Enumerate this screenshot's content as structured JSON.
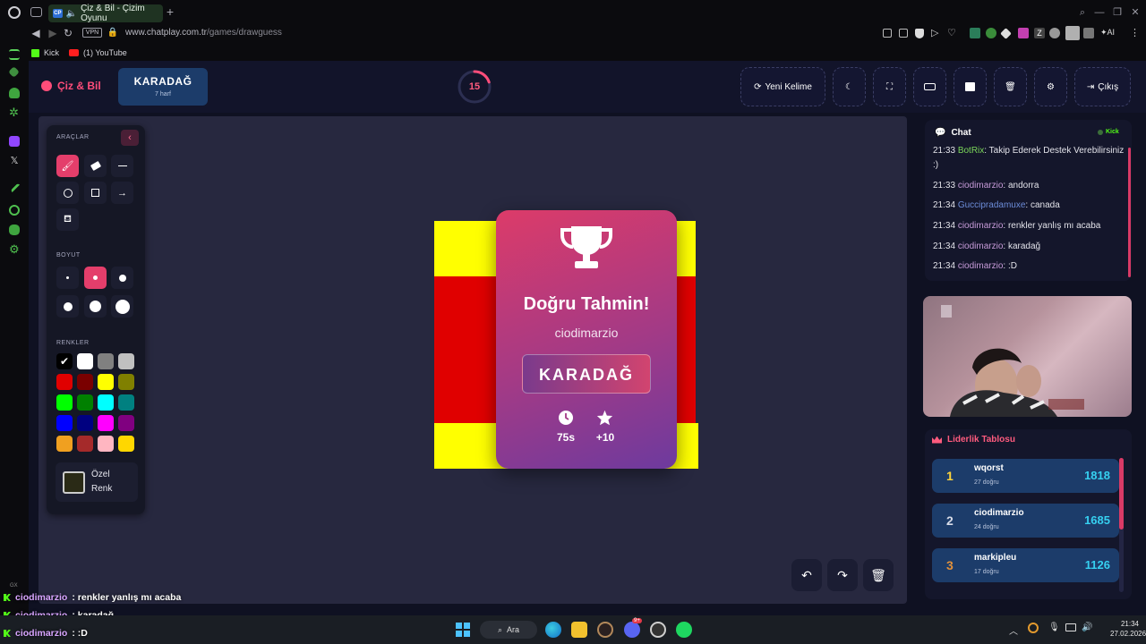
{
  "browser": {
    "tab_title": "Çiz & Bil - Çizim Oyunu",
    "tab_favicon": "CP",
    "vpn_label": "VPN",
    "url_domain": "www.chatplay.com.tr",
    "url_path": "/games/drawguess",
    "bookmarks": [
      "Kick",
      "(1) YouTube"
    ],
    "ai_label": "AI"
  },
  "header": {
    "logo_text": "Çiz & Bil",
    "word": "KARADAĞ",
    "word_hint": "7 harf",
    "timer": "15",
    "timer_fraction": 0.2,
    "new_word_label": "Yeni Kelime",
    "exit_label": "Çıkış"
  },
  "tools": {
    "section_tools": "ARAÇLAR",
    "section_size": "BOYUT",
    "section_colors": "RENKLER",
    "custom_color_label": "Özel Renk",
    "colors": [
      "#000000",
      "#ffffff",
      "#808080",
      "#c0c0c0",
      "#e00000",
      "#7a0000",
      "#ffff00",
      "#808000",
      "#00ff00",
      "#008000",
      "#00ffff",
      "#008080",
      "#0000ff",
      "#000080",
      "#ff00ff",
      "#800080",
      "#f0a020",
      "#a52a2a",
      "#ffb6c1",
      "#ffd700"
    ],
    "selected_color": "#000000",
    "custom_color": "#2a2a16"
  },
  "modal": {
    "title": "Doğru Tahmin!",
    "user": "ciodimarzio",
    "word": "KARADAĞ",
    "time": "75s",
    "points": "+10"
  },
  "chat": {
    "title": "Chat",
    "platform": "Kick",
    "messages": [
      {
        "time": "21:33",
        "user": "BotRix",
        "text": ": Takip Ederek Destek Verebilirsiniz :)"
      },
      {
        "time": "21:33",
        "user": "ciodimarzio",
        "text": ": andorra"
      },
      {
        "time": "21:34",
        "user": "Guccipradamuxe",
        "text": ": canada"
      },
      {
        "time": "21:34",
        "user": "ciodimarzio",
        "text": ": renkler yanlış mı acaba"
      },
      {
        "time": "21:34",
        "user": "ciodimarzio",
        "text": ": karadağ"
      },
      {
        "time": "21:34",
        "user": "ciodimarzio",
        "text": ": :D"
      }
    ]
  },
  "leaderboard": {
    "title": "Liderlik Tablosu",
    "rows": [
      {
        "rank": "1",
        "name": "wqorst",
        "sub": "27 doğru",
        "score": "1818"
      },
      {
        "rank": "2",
        "name": "ciodimarzio",
        "sub": "24 doğru",
        "score": "1685"
      },
      {
        "rank": "3",
        "name": "markipleu",
        "sub": "17 doğru",
        "score": "1126"
      }
    ]
  },
  "overlay_chat": [
    {
      "user": "ciodimarzio",
      "text": " : renkler yanlış mı acaba"
    },
    {
      "user": "ciodimarzio",
      "text": " : karadağ"
    },
    {
      "user": "ciodimarzio",
      "text": " : :D"
    }
  ],
  "overlay_gx": "GX",
  "taskbar": {
    "search_label": "Ara",
    "time": "21:34",
    "date": "27.02.2026",
    "discord_badge": "9+"
  }
}
